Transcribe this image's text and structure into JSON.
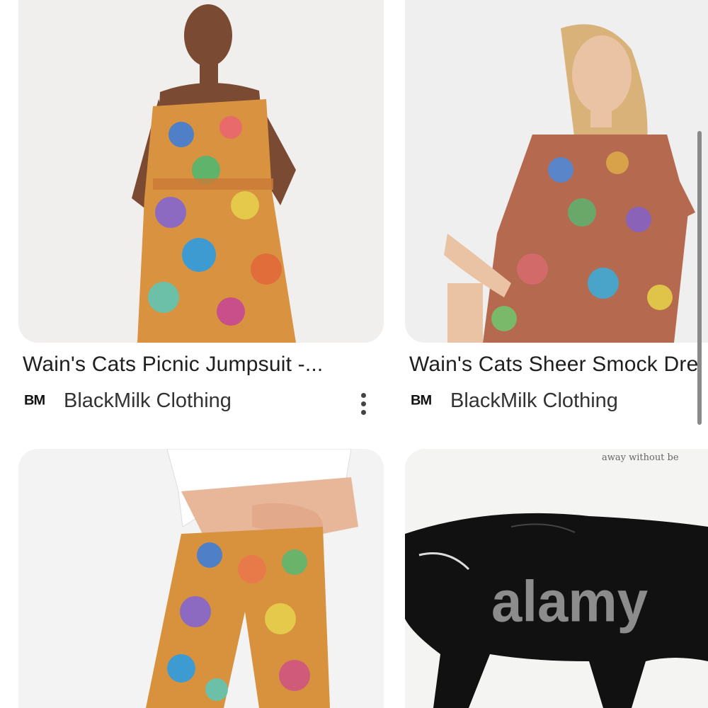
{
  "results": [
    {
      "title": "Wain's Cats Picnic Jumpsuit -...",
      "source_logo": "BM",
      "source_name": "BlackMilk Clothing",
      "has_more_menu": true
    },
    {
      "title": "Wain's Cats Sheer Smock Dre",
      "source_logo": "BM",
      "source_name": "BlackMilk Clothing",
      "has_more_menu": false
    },
    {
      "title": "",
      "source_logo": "",
      "source_name": ""
    },
    {
      "title": "",
      "source_logo": "",
      "source_name": "",
      "overlay_caption": "away without be",
      "watermark": "alamy"
    }
  ],
  "icons": {
    "more": "more-vert-icon"
  },
  "colors": {
    "title": "#1f1f1f",
    "source": "#333333",
    "thumb_bg": "#ececec",
    "scrollbar": "#8a8a8a"
  }
}
